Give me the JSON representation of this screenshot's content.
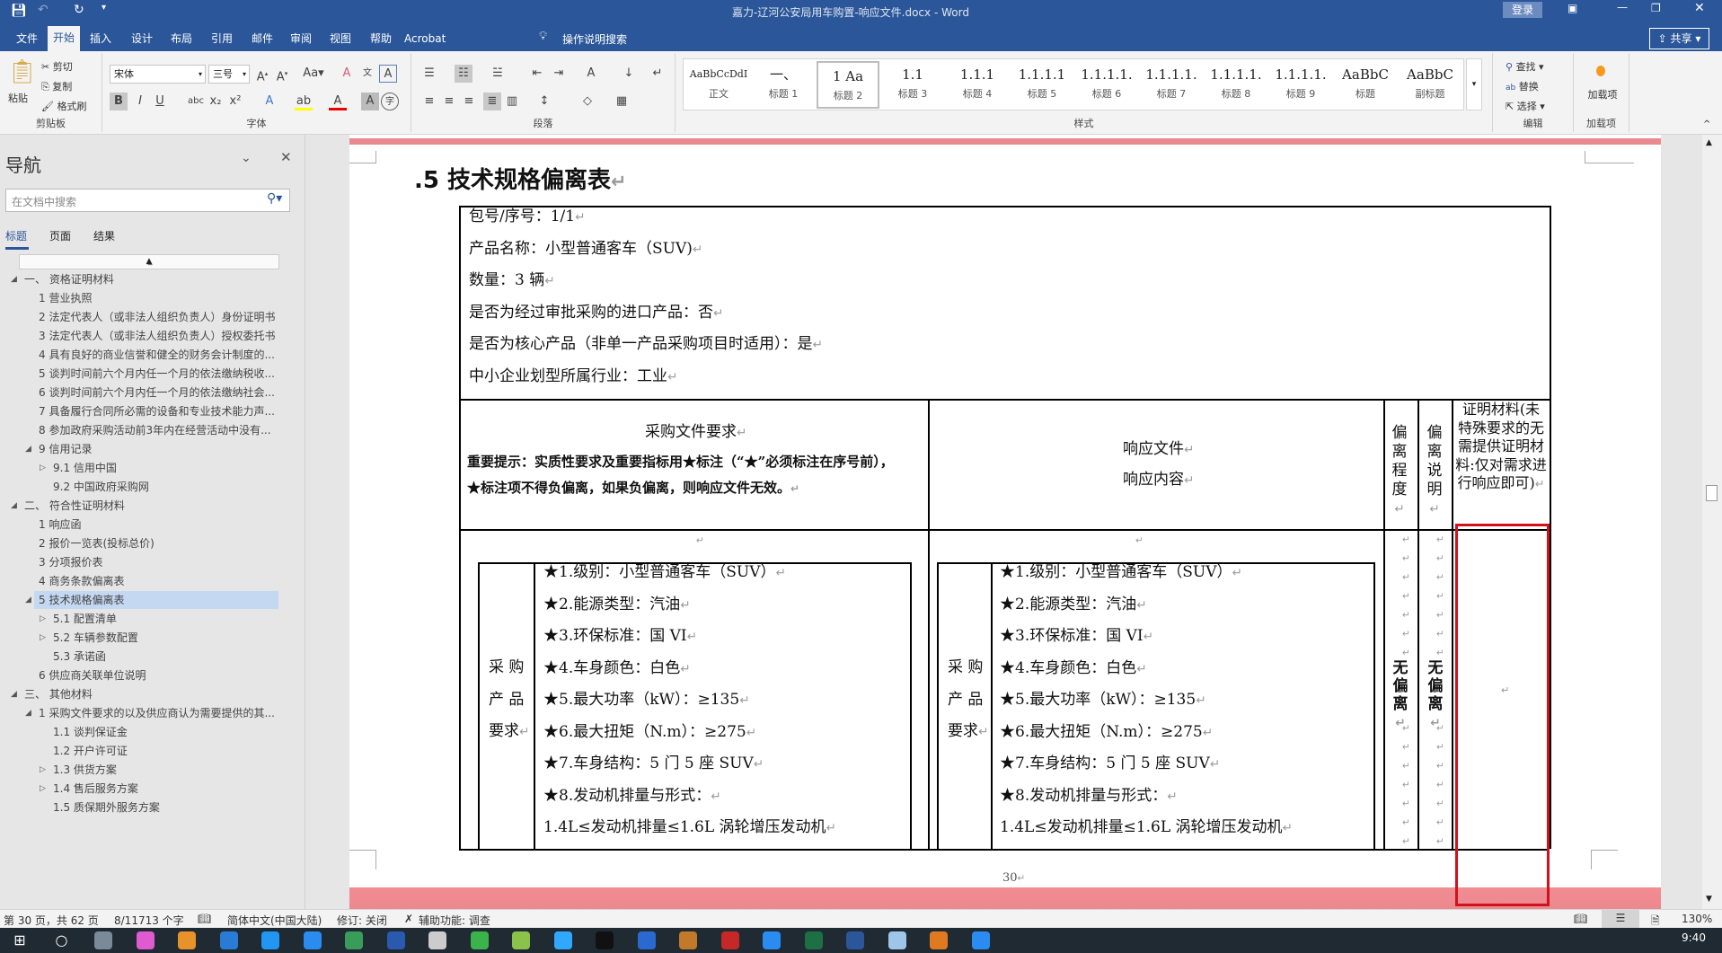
{
  "titlebar": {
    "doc_title": "嘉力-辽河公安局用车购置-响应文件.docx  -  Word",
    "login": "登录",
    "share": "共享"
  },
  "menu_tabs": [
    "文件",
    "开始",
    "插入",
    "设计",
    "布局",
    "引用",
    "邮件",
    "审阅",
    "视图",
    "帮助",
    "Acrobat"
  ],
  "active_tab": "开始",
  "tell_me": "操作说明搜索",
  "ribbon": {
    "clipboard": {
      "paste": "粘贴",
      "cut": "剪切",
      "copy": "复制",
      "format_painter": "格式刷",
      "label": "剪贴板"
    },
    "font": {
      "font_name": "宋体",
      "font_size": "三号",
      "label": "字体"
    },
    "paragraph": {
      "label": "段落"
    },
    "styles": {
      "label": "样式",
      "items": [
        {
          "preview": "AaBbCcDdI",
          "name": "正文"
        },
        {
          "preview": "一、",
          "name": "标题 1"
        },
        {
          "preview": "1  Aa",
          "name": "标题 2"
        },
        {
          "preview": "1.1  ",
          "name": "标题 3"
        },
        {
          "preview": "1.1.1",
          "name": "标题 4"
        },
        {
          "preview": "1.1.1.1",
          "name": "标题 5"
        },
        {
          "preview": "1.1.1.1.",
          "name": "标题 6"
        },
        {
          "preview": "1.1.1.1.",
          "name": "标题 7"
        },
        {
          "preview": "1.1.1.1.",
          "name": "标题 8"
        },
        {
          "preview": "1.1.1.1.",
          "name": "标题 9"
        },
        {
          "preview": "AaBbC",
          "name": "标题"
        },
        {
          "preview": "AaBbC",
          "name": "副标题"
        }
      ],
      "selected": "标题 2"
    },
    "editing": {
      "find": "查找",
      "replace": "替换",
      "select": "选择",
      "label": "编辑"
    },
    "addins": {
      "button": "加载项",
      "label": "加载项"
    }
  },
  "nav": {
    "title": "导航",
    "search_placeholder": "在文档中搜索",
    "tabs": [
      "标题",
      "页面",
      "结果"
    ],
    "active_tab": "标题",
    "items": [
      {
        "level": 0,
        "text": "一、  资格证明材料",
        "arrow": "expanded"
      },
      {
        "level": 1,
        "text": "1 营业执照"
      },
      {
        "level": 1,
        "text": "2 法定代表人（或非法人组织负责人）身份证明书"
      },
      {
        "level": 1,
        "text": "3 法定代表人（或非法人组织负责人）授权委托书"
      },
      {
        "level": 1,
        "text": "4 具有良好的商业信誉和健全的财务会计制度的..."
      },
      {
        "level": 1,
        "text": "5 谈判时间前六个月内任一个月的依法缴纳税收..."
      },
      {
        "level": 1,
        "text": "6 谈判时间前六个月内任一个月的依法缴纳社会..."
      },
      {
        "level": 1,
        "text": "7 具备履行合同所必需的设备和专业技术能力声..."
      },
      {
        "level": 1,
        "text": "8 参加政府采购活动前3年内在经营活动中没有..."
      },
      {
        "level": 1,
        "text": "9 信用记录",
        "arrow": "expanded"
      },
      {
        "level": 2,
        "text": "9.1 信用中国",
        "arrow": "collapsed"
      },
      {
        "level": 2,
        "text": "9.2 中国政府采购网"
      },
      {
        "level": 0,
        "text": "二、  符合性证明材料",
        "arrow": "expanded"
      },
      {
        "level": 1,
        "text": "1 响应函"
      },
      {
        "level": 1,
        "text": "2 报价一览表(投标总价)"
      },
      {
        "level": 1,
        "text": "3 分项报价表"
      },
      {
        "level": 1,
        "text": "4 商务条款偏离表"
      },
      {
        "level": 1,
        "text": "5 技术规格偏离表",
        "arrow": "expanded",
        "selected": true
      },
      {
        "level": 2,
        "text": "5.1 配置清单",
        "arrow": "collapsed"
      },
      {
        "level": 2,
        "text": "5.2 车辆参数配置",
        "arrow": "collapsed"
      },
      {
        "level": 2,
        "text": "5.3 承诺函"
      },
      {
        "level": 1,
        "text": "6 供应商关联单位说明"
      },
      {
        "level": 0,
        "text": "三、  其他材料",
        "arrow": "expanded"
      },
      {
        "level": 1,
        "text": "1 采购文件要求的以及供应商认为需要提供的其...",
        "arrow": "expanded"
      },
      {
        "level": 2,
        "text": "1.1 谈判保证金"
      },
      {
        "level": 2,
        "text": "1.2 开户许可证"
      },
      {
        "level": 2,
        "text": "1.3 供货方案",
        "arrow": "collapsed"
      },
      {
        "level": 2,
        "text": "1.4 售后服务方案",
        "arrow": "collapsed"
      },
      {
        "level": 2,
        "text": "1.5 质保期外服务方案"
      }
    ]
  },
  "document": {
    "heading": ".5 技术规格偏离表",
    "info": [
      "包号/序号：1/1",
      "产品名称：小型普通客车（SUV)",
      "数量：3 辆",
      "是否为经过审批采购的进口产品：否",
      "是否为核心产品（非单一产品采购项目时适用）：是",
      "中小企业划型所属行业：工业"
    ],
    "header": {
      "req_title": "采购文件要求",
      "req_note1": "重要提示：实质性要求及重要指标用★标注（“★”必须标注在序号前），",
      "req_note2": "★标注项不得负偏离，如果负偏离，则响应文件无效。",
      "resp_line1": "响应文件",
      "resp_line2": "响应内容",
      "deviation_degree": "偏离程度",
      "deviation_note": "偏离说明",
      "proof": "证明材料(未特殊要求的无需提供证明材料:仅对需求进行响应即可)"
    },
    "row_label": [
      "采 购",
      "产 品",
      "要求"
    ],
    "spec_lines": [
      "★1.级别：小型普通客车（SUV）",
      "★2.能源类型：汽油",
      "★3.环保标准：国 VI",
      "★4.车身颜色：白色",
      "★5.最大功率（kW）：≥135",
      "★6.最大扭矩（N.m）：≥275",
      "★7.车身结构：5 门 5 座 SUV",
      "★8.发动机排量与形式：",
      "1.4L≤发动机排量≤1.6L   涡轮增压发动机"
    ],
    "deviation_degree_value": "无偏离",
    "deviation_note_value": "无偏离",
    "page_number": "30"
  },
  "highlight_color": "#d0121f",
  "status": {
    "page": "第 30 页，共 62 页",
    "words": "8/11713 个字",
    "language": "简体中文(中国大陆)",
    "track": "修订: 关闭",
    "accessibility": "辅助功能: 调查",
    "zoom": "130%"
  },
  "taskbar": {
    "time": "9:40",
    "apps": [
      "start",
      "search",
      "calculator",
      "color-app",
      "browser",
      "app-dots",
      "doc-app",
      "blue-app",
      "green-app",
      "kingsoft",
      "file-app",
      "wechat",
      "pen-app",
      "photoshop",
      "qq",
      "xin",
      "edge-app",
      "acrobat",
      "q-app",
      "excel",
      "word",
      "pencil-app",
      "tool-app",
      "pin-app"
    ]
  }
}
